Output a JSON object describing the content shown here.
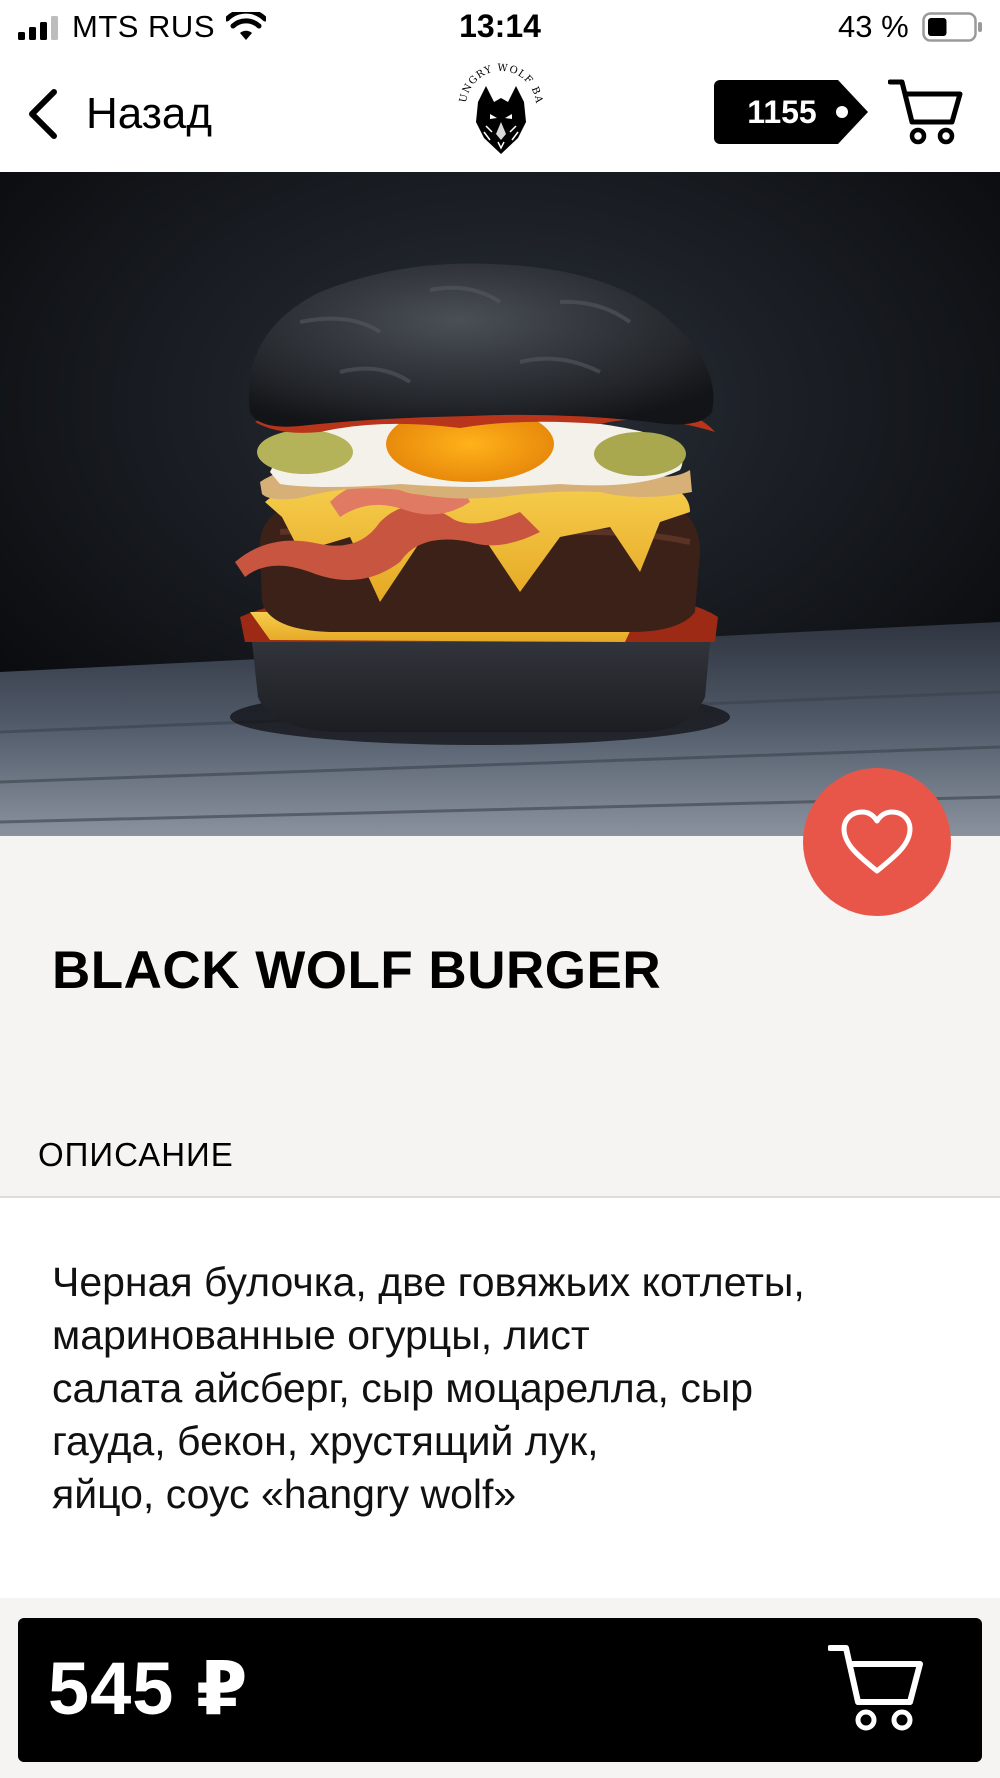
{
  "status_bar": {
    "carrier": "MTS RUS",
    "time": "13:14",
    "battery_text": "43 %",
    "battery_level": 0.43,
    "icons": [
      "signal-icon",
      "wifi-icon",
      "battery-icon"
    ]
  },
  "nav": {
    "back_label": "Назад",
    "back_icon": "chevron-left-icon",
    "logo_text": "HUNGRY WOLF BAR",
    "bonus_points": "1155",
    "cart_icon": "cart-icon"
  },
  "product": {
    "photo_subject": "black-bun-burger-photo",
    "favorite_icon": "heart-icon",
    "title": "BLACK WOLF BURGER",
    "section_label": "ОПИСАНИЕ",
    "description_lines": [
      "Черная булочка, две говяжьих котлеты,",
      "маринованные огурцы, лист",
      "салата айсберг, сыр моцарелла, сыр",
      "гауда, бекон, хрустящий лук,",
      "яйцо, соус «hangry wolf»"
    ],
    "price": "545 ₽"
  },
  "colors": {
    "accent_favorite": "#e8564a",
    "price_bar": "#000000",
    "content_bg": "#f5f4f3"
  }
}
